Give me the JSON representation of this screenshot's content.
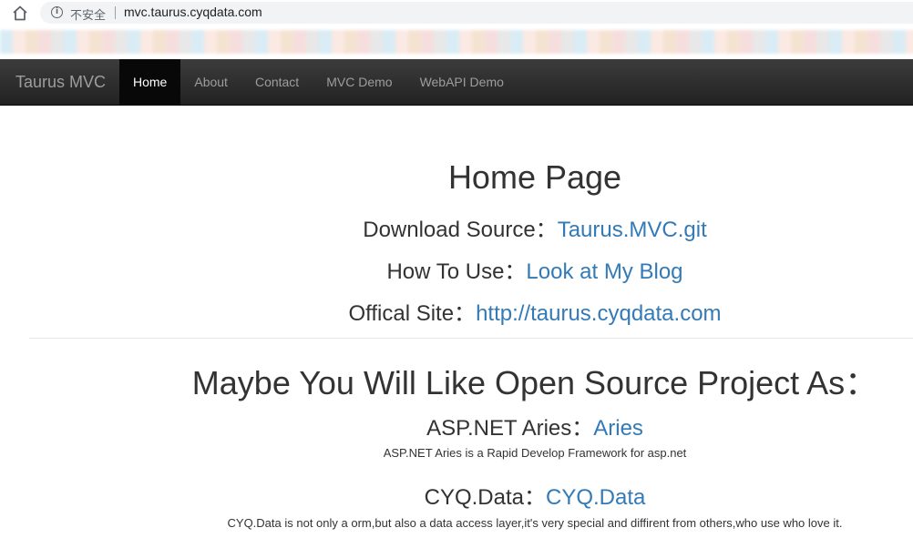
{
  "browser": {
    "insecure_label": "不安全",
    "url": "mvc.taurus.cyqdata.com",
    "home_icon": "home-icon",
    "info_icon": "info-icon",
    "info_glyph": "i"
  },
  "navbar": {
    "brand": "Taurus MVC",
    "items": [
      {
        "label": "Home",
        "active": true
      },
      {
        "label": "About",
        "active": false
      },
      {
        "label": "Contact",
        "active": false
      },
      {
        "label": "MVC Demo",
        "active": false
      },
      {
        "label": "WebAPI Demo",
        "active": false
      }
    ],
    "colors": {
      "background": "#222222",
      "active_bg": "#080808",
      "text": "#9d9d9d",
      "active_text": "#ffffff"
    }
  },
  "main": {
    "title": "Home Page",
    "lines": [
      {
        "label": "Download Source：",
        "link": "Taurus.MVC.git"
      },
      {
        "label": "How To Use：",
        "link": "Look at My Blog"
      },
      {
        "label": "Offical Site：",
        "link": "http://taurus.cyqdata.com"
      }
    ],
    "projects_heading": "Maybe You Will Like Open Source Project As：",
    "projects": [
      {
        "label": "ASP.NET Aries：",
        "link": "Aries",
        "description": "ASP.NET Aries is a Rapid Develop Framework for asp.net"
      },
      {
        "label": "CYQ.Data：",
        "link": "CYQ.Data",
        "description": "CYQ.Data is not only a orm,but also a data access layer,it's very special and diffirent from others,who use who love it."
      }
    ],
    "colors": {
      "text": "#333333",
      "link": "#337ab7"
    }
  }
}
